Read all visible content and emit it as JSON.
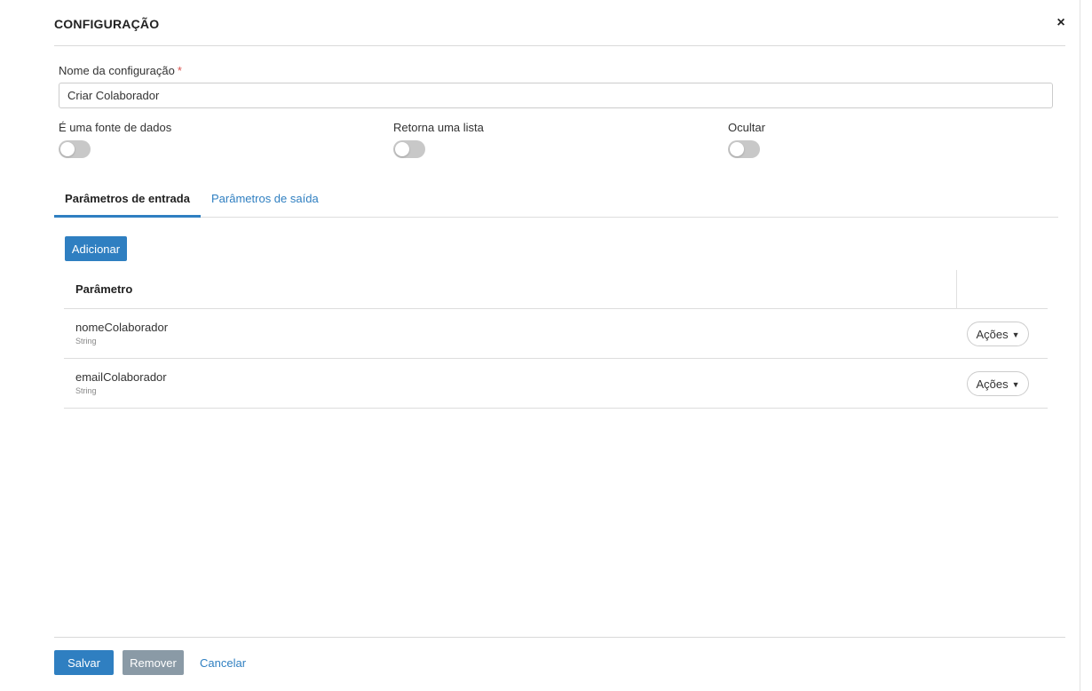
{
  "modal": {
    "title": "CONFIGURAÇÃO",
    "close_label": "×"
  },
  "form": {
    "name_label": "Nome da configuração",
    "required_mark": "*",
    "name_value": "Criar Colaborador"
  },
  "toggles": [
    {
      "label": "É uma fonte de dados",
      "on": false
    },
    {
      "label": "Retorna uma lista",
      "on": false
    },
    {
      "label": "Ocultar",
      "on": false
    }
  ],
  "tabs": [
    {
      "label": "Parâmetros de entrada",
      "active": true
    },
    {
      "label": "Parâmetros de saída",
      "active": false
    }
  ],
  "table": {
    "add_label": "Adicionar",
    "header": "Parâmetro",
    "actions_label": "Ações",
    "rows": [
      {
        "name": "nomeColaborador",
        "type": "String"
      },
      {
        "name": "emailColaborador",
        "type": "String"
      }
    ]
  },
  "footer": {
    "save_label": "Salvar",
    "remove_label": "Remover",
    "cancel_label": "Cancelar"
  },
  "colors": {
    "accent": "#2f7fc1",
    "required": "#d9534f",
    "remove_button": "#8a9aa6",
    "toggle_off": "#c8c8c8"
  },
  "icons": {
    "close": "close-icon",
    "caret": "caret-down-icon"
  }
}
